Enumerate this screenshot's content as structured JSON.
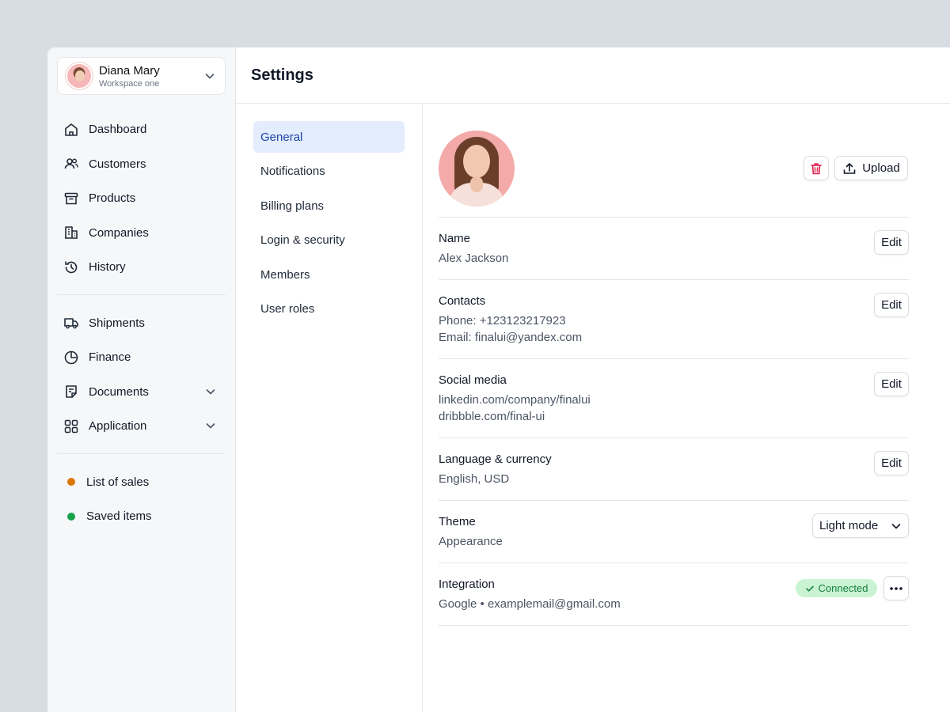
{
  "workspace": {
    "name": "Diana Mary",
    "subtitle": "Workspace one"
  },
  "sidebar": {
    "main_items": [
      {
        "label": "Dashboard",
        "icon": "home-icon"
      },
      {
        "label": "Customers",
        "icon": "users-icon"
      },
      {
        "label": "Products",
        "icon": "archive-icon"
      },
      {
        "label": "Companies",
        "icon": "building-icon"
      },
      {
        "label": "History",
        "icon": "history-icon"
      }
    ],
    "secondary_items": [
      {
        "label": "Shipments",
        "icon": "truck-icon"
      },
      {
        "label": "Finance",
        "icon": "pie-chart-icon"
      },
      {
        "label": "Documents",
        "icon": "document-icon",
        "expandable": true
      },
      {
        "label": "Application",
        "icon": "grid-icon",
        "expandable": true
      }
    ],
    "lists": [
      {
        "label": "List of sales",
        "color": "#d97706"
      },
      {
        "label": "Saved items",
        "color": "#16a34a"
      }
    ]
  },
  "header": {
    "title": "Settings"
  },
  "subnav": {
    "items": [
      "General",
      "Notifications",
      "Billing plans",
      "Login & security",
      "Members",
      "User roles"
    ],
    "active": "General"
  },
  "profile": {
    "upload_label": "Upload",
    "rows": {
      "name": {
        "title": "Name",
        "value": "Alex Jackson",
        "action": "Edit"
      },
      "contacts": {
        "title": "Contacts",
        "phone": "Phone: +123123217923",
        "email": "Email: finalui@yandex.com",
        "action": "Edit"
      },
      "social": {
        "title": "Social media",
        "link1": "linkedin.com/company/finalui",
        "link2": "dribbble.com/final-ui",
        "action": "Edit"
      },
      "language": {
        "title": "Language & currency",
        "value": "English, USD",
        "action": "Edit"
      },
      "theme": {
        "title": "Theme",
        "value": "Appearance",
        "mode": "Light mode"
      },
      "integration": {
        "title": "Integration",
        "value": "Google • examplemail@gmail.com",
        "status": "Connected"
      }
    }
  },
  "colors": {
    "accent": "#1f45a8",
    "active_bg": "#e3edfd",
    "danger": "#e11d48",
    "success_bg": "#c9f3d2",
    "success_text": "#15803d"
  }
}
